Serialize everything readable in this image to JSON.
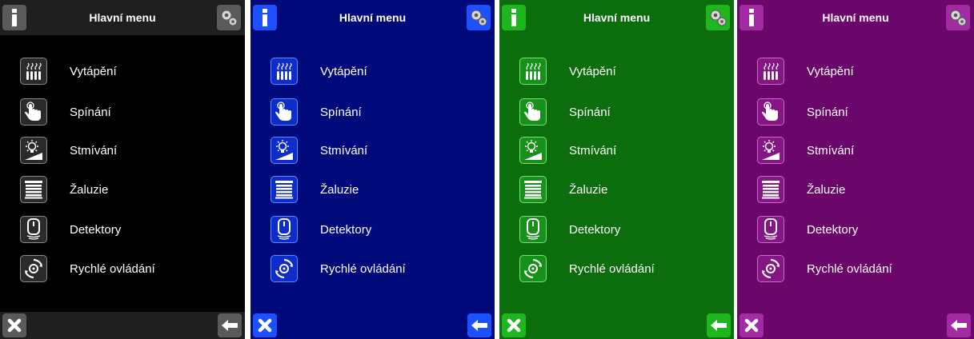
{
  "themes": [
    {
      "name": "black",
      "bg": "#000000",
      "bar": "#1e1e1e",
      "btn": "#5a5a5a",
      "icon_bg": "#2a2a2a",
      "icon_border": "#8a8a8a"
    },
    {
      "name": "blue",
      "bg": "#000a7a",
      "bar": "#000a7a",
      "btn": "#1d50ff",
      "icon_bg": "#0d2cc9",
      "icon_border": "#5e8cff"
    },
    {
      "name": "green",
      "bg": "#0c6d0c",
      "bar": "#0c6d0c",
      "btn": "#1fb51f",
      "icon_bg": "#18911a",
      "icon_border": "#7be07b"
    },
    {
      "name": "purple",
      "bg": "#6b076b",
      "bar": "#6b076b",
      "btn": "#a22aa2",
      "icon_bg": "#861686",
      "icon_border": "#c86ac8"
    }
  ],
  "header": {
    "title": "Hlavní menu",
    "info_icon": "info-icon",
    "settings_icon": "gears-icon"
  },
  "menu": [
    {
      "label": "Vytápění",
      "icon": "heating-icon"
    },
    {
      "label": "Spínání",
      "icon": "switching-hand-icon"
    },
    {
      "label": "Stmívání",
      "icon": "dimming-bulb-icon"
    },
    {
      "label": "Žaluzie",
      "icon": "blinds-icon"
    },
    {
      "label": "Detektory",
      "icon": "detector-icon"
    },
    {
      "label": "Rychlé ovládání",
      "icon": "quick-control-icon"
    }
  ],
  "footer": {
    "close_icon": "close-icon",
    "back_icon": "back-arrow-icon"
  }
}
